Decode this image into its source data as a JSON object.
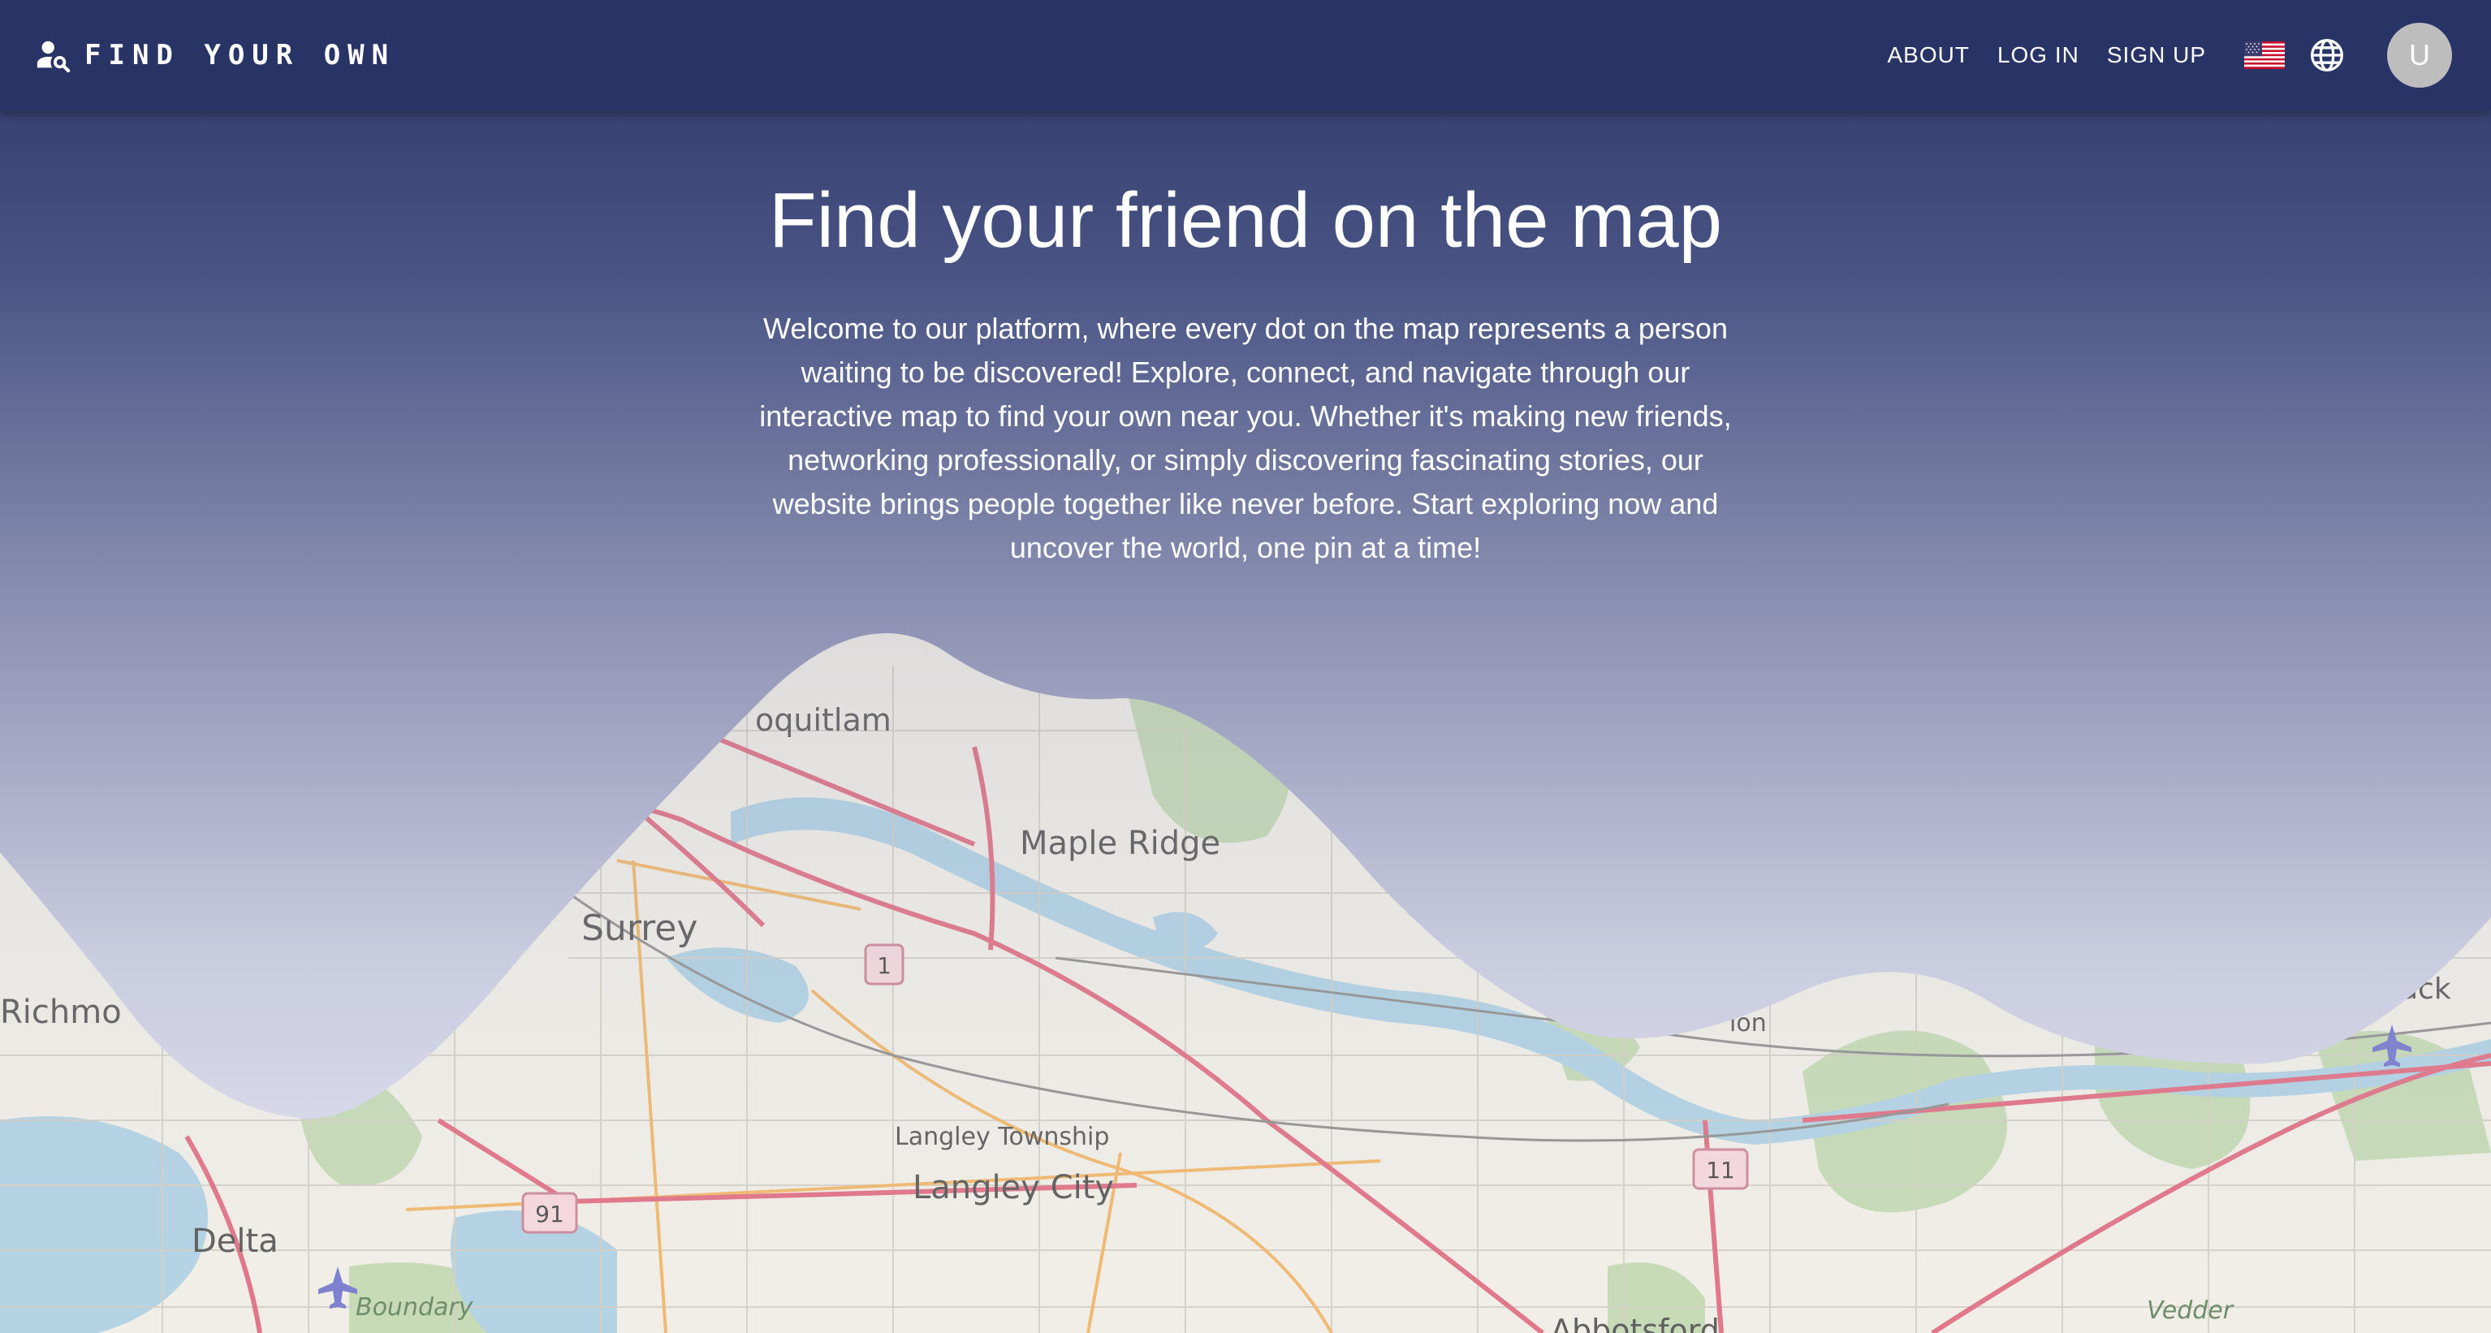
{
  "appbar": {
    "brand": "FIND YOUR OWN",
    "nav": [
      {
        "label": "ABOUT"
      },
      {
        "label": "LOG IN"
      },
      {
        "label": "SIGN UP"
      }
    ],
    "language_flag": "us-flag-icon",
    "language_icon": "globe-icon",
    "avatar_letter": "U"
  },
  "hero": {
    "title": "Find your friend on the map",
    "description": "Welcome to our platform, where every dot on the map represents a person waiting to be discovered! Explore, connect, and navigate through our interactive map to find your own near you. Whether it's making new friends, networking professionally, or simply discovering fascinating stories, our website brings people together like never before. Start exploring now and uncover the world, one pin at a time!"
  },
  "map": {
    "places": [
      {
        "name": "oquitlam"
      },
      {
        "name": "Maple Ridge"
      },
      {
        "name": "Surrey"
      },
      {
        "name": "Richmo"
      },
      {
        "name": "Langley Township"
      },
      {
        "name": "Langley City"
      },
      {
        "name": "Delta"
      },
      {
        "name": "Boundary"
      },
      {
        "name": "ion"
      },
      {
        "name": "ack"
      },
      {
        "name": "Vedder"
      },
      {
        "name": "Abbotsford"
      }
    ],
    "shields": [
      {
        "label": "1"
      },
      {
        "label": "91"
      },
      {
        "label": "11"
      }
    ]
  },
  "colors": {
    "appbar": "#283366",
    "gradient_top": "#2a3566",
    "gradient_bottom": "#d2d4e6",
    "map_land": "#efece4",
    "map_water": "#a9cde0",
    "map_park": "#b5d3a4",
    "road_major": "#e0637a",
    "road_secondary": "#f1b45e",
    "avatar": "#bdbdbd"
  }
}
